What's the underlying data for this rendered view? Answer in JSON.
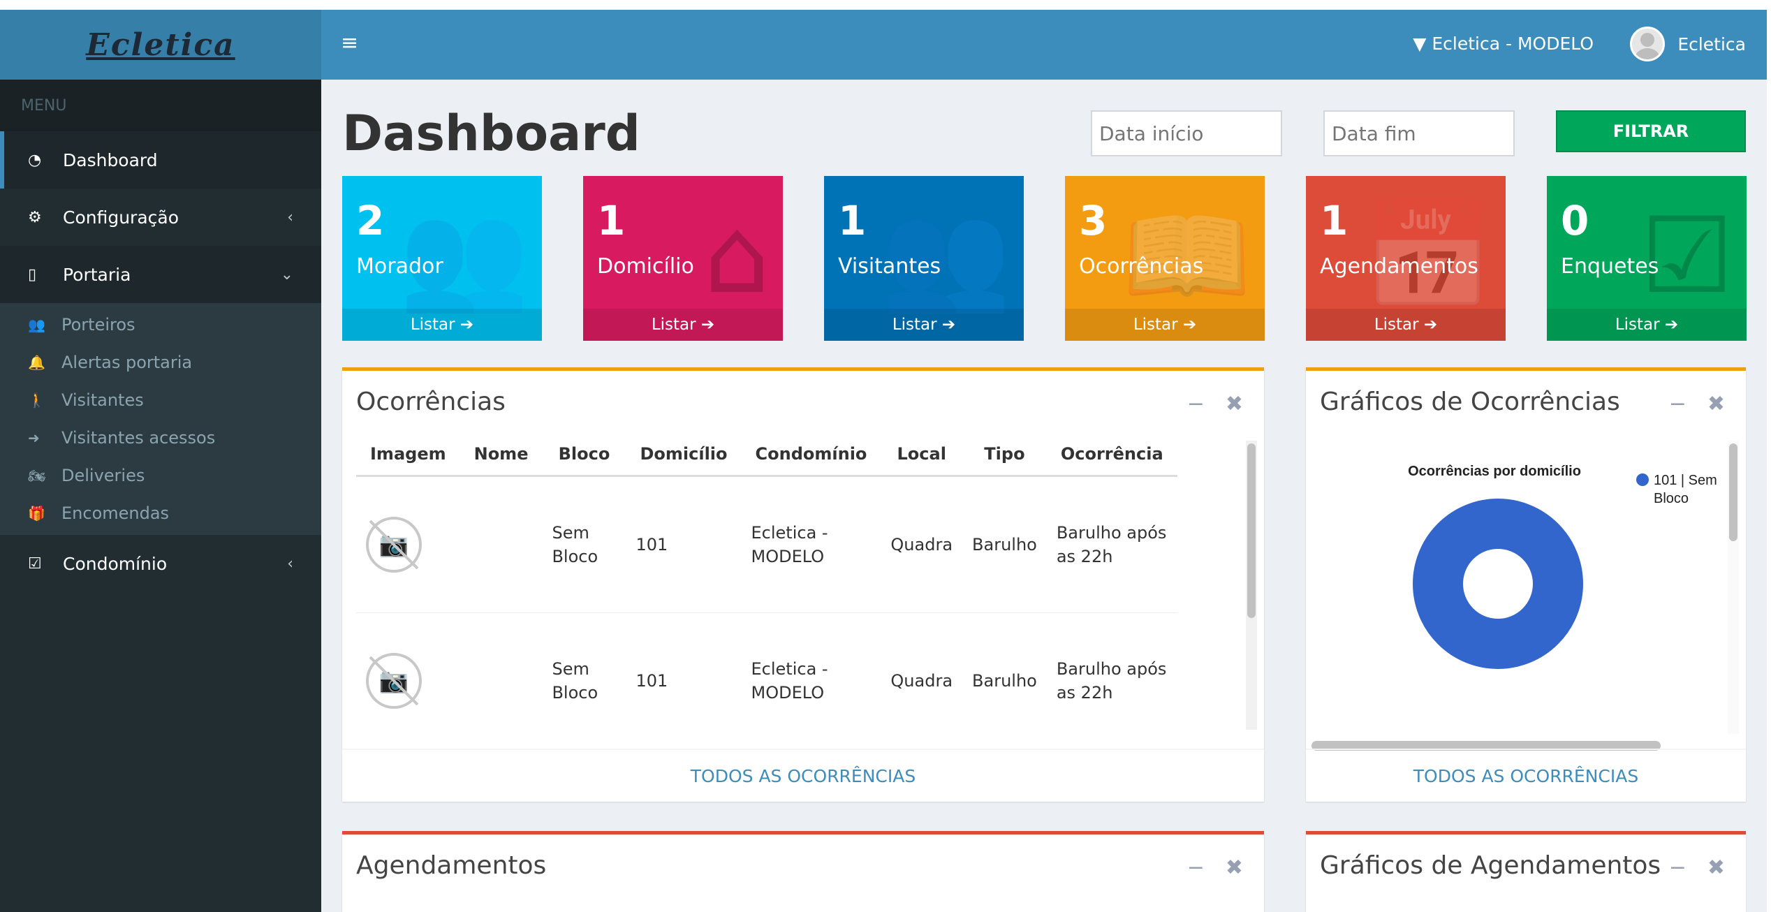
{
  "app": {
    "logo": "Ecletica"
  },
  "sidebar": {
    "header": "MENU",
    "items": [
      {
        "label": "Dashboard",
        "icon": "dashboard-icon"
      },
      {
        "label": "Configuração",
        "icon": "gears-icon"
      },
      {
        "label": "Portaria",
        "icon": "mobile-icon"
      },
      {
        "label": "Condomínio",
        "icon": "check-square-icon"
      }
    ],
    "submenu": [
      {
        "label": "Porteiros",
        "icon": "users-icon"
      },
      {
        "label": "Alertas portaria",
        "icon": "bell-icon"
      },
      {
        "label": "Visitantes",
        "icon": "male-icon"
      },
      {
        "label": "Visitantes acessos",
        "icon": "sign-in-icon"
      },
      {
        "label": "Deliveries",
        "icon": "motorcycle-icon"
      },
      {
        "label": "Encomendas",
        "icon": "gift-icon"
      }
    ]
  },
  "topbar": {
    "condominio": "Ecletica - MODELO",
    "user": "Ecletica"
  },
  "page": {
    "title": "Dashboard"
  },
  "filter": {
    "start_placeholder": "Data início",
    "end_placeholder": "Data fim",
    "button": "FILTRAR"
  },
  "tiles": [
    {
      "count": "2",
      "label": "Morador",
      "link": "Listar",
      "color": "#00c0ef"
    },
    {
      "count": "1",
      "label": "Domicílio",
      "link": "Listar",
      "color": "#d81b60"
    },
    {
      "count": "1",
      "label": "Visitantes",
      "link": "Listar",
      "color": "#0073b7"
    },
    {
      "count": "3",
      "label": "Ocorrências",
      "link": "Listar",
      "color": "#f39c12"
    },
    {
      "count": "1",
      "label": "Agendamentos",
      "link": "Listar",
      "color": "#dd4b39"
    },
    {
      "count": "0",
      "label": "Enquetes",
      "link": "Listar",
      "color": "#00a65a"
    }
  ],
  "ocorrencias": {
    "title": "Ocorrências",
    "columns": [
      "Imagem",
      "Nome",
      "Bloco",
      "Domicílio",
      "Condomínio",
      "Local",
      "Tipo",
      "Ocorrência"
    ],
    "rows": [
      {
        "nome": "",
        "bloco": "Sem Bloco",
        "domicilio": "101",
        "condominio": "Ecletica - MODELO",
        "local": "Quadra",
        "tipo": "Barulho",
        "ocorrencia": "Barulho após as 22h"
      },
      {
        "nome": "",
        "bloco": "Sem Bloco",
        "domicilio": "101",
        "condominio": "Ecletica - MODELO",
        "local": "Quadra",
        "tipo": "Barulho",
        "ocorrencia": "Barulho após as 22h"
      }
    ],
    "footer": "TODOS AS OCORRÊNCIAS"
  },
  "graficos_ocorrencias": {
    "title": "Gráficos de Ocorrências",
    "footer": "TODOS AS OCORRÊNCIAS"
  },
  "chart_data": {
    "type": "pie",
    "title": "Ocorrências por domicílio",
    "categories": [
      "101 | Sem Bloco"
    ],
    "values": [
      3
    ],
    "colors": [
      "#3366cc"
    ],
    "legend": "right"
  },
  "agendamentos": {
    "title": "Agendamentos"
  },
  "graficos_agendamentos": {
    "title": "Gráficos de Agendamentos"
  },
  "icons": {
    "minimize": "−",
    "close": "✖",
    "circle_arrow": "➔"
  }
}
